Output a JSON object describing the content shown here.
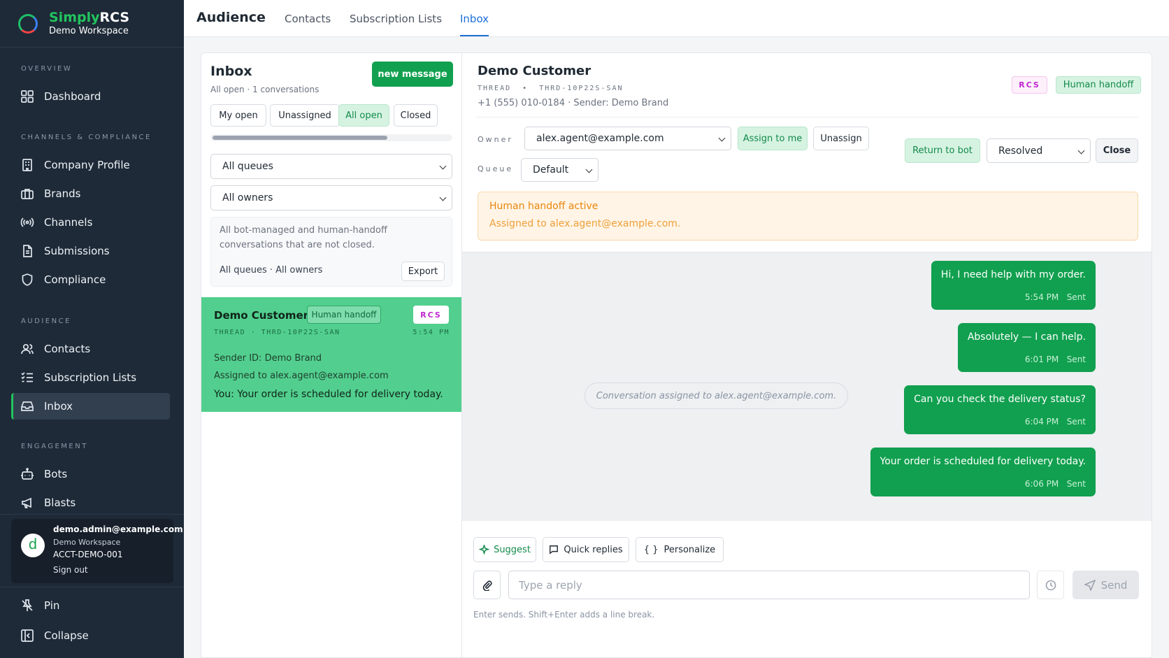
{
  "brand": {
    "simply": "Simply",
    "rcs": "RCS",
    "workspace": "Demo Workspace"
  },
  "nav": {
    "overview_label": "Overview",
    "dashboard": "Dashboard",
    "channels_label": "Channels & Compliance",
    "company_profile": "Company Profile",
    "brands": "Brands",
    "channels": "Channels",
    "submissions": "Submissions",
    "compliance": "Compliance",
    "audience_label": "Audience",
    "contacts": "Contacts",
    "subscription_lists": "Subscription Lists",
    "inbox": "Inbox",
    "engagement_label": "Engagement",
    "bots": "Bots",
    "blasts": "Blasts",
    "pin": "Pin",
    "collapse": "Collapse"
  },
  "user": {
    "initial": "d",
    "email": "demo.admin@example.com",
    "workspace": "Demo Workspace",
    "account": "ACCT-DEMO-001",
    "signout": "Sign out"
  },
  "header": {
    "title": "Audience",
    "tabs": [
      "Contacts",
      "Subscription Lists",
      "Inbox"
    ],
    "active_tab": "Inbox"
  },
  "inbox": {
    "title": "Inbox",
    "subtitle": "All open · 1 conversations",
    "new_message": "new message",
    "filters": [
      "My open",
      "Unassigned",
      "All open",
      "Closed"
    ],
    "queue_select": "All queues",
    "owner_select": "All owners",
    "description": "All bot-managed and human-handoff conversations that are not closed.",
    "summary": "All queues · All owners",
    "export": "Export",
    "conversation": {
      "name": "Demo Customer",
      "handoff_badge": "Human handoff",
      "channel": "RCS",
      "thread": "THREAD · THRD-10P22S-SAN",
      "time": "5:54 PM",
      "sender": "Sender ID: Demo Brand",
      "assigned": "Assigned to alex.agent@example.com",
      "preview": "You: Your order is scheduled for delivery today."
    }
  },
  "thread": {
    "name": "Demo Customer",
    "thread_id": "THREAD  •  THRD-10P22S-SAN",
    "contact": "+1 (555) 010-0184 · Sender: Demo Brand",
    "channel_badge": "RCS",
    "handoff_badge": "Human handoff",
    "owner_label": "Owner",
    "owner_value": "alex.agent@example.com",
    "assign_me": "Assign to me",
    "unassign": "Unassign",
    "queue_label": "Queue",
    "queue_value": "Default",
    "return_bot": "Return to bot",
    "status_value": "Resolved",
    "close": "Close",
    "alert_title": "Human handoff active",
    "alert_text": "Assigned to alex.agent@example.com."
  },
  "messages": [
    {
      "text": "Hi, I need help with my order.",
      "time": "5:54 PM",
      "status": "Sent"
    },
    {
      "text": "Absolutely — I can help.",
      "time": "6:01 PM",
      "status": "Sent"
    },
    {
      "text": "Can you check the delivery status?",
      "time": "6:04 PM",
      "status": "Sent"
    },
    {
      "text": "Your order is scheduled for delivery today.",
      "time": "6:06 PM",
      "status": "Sent"
    }
  ],
  "system_note": "Conversation assigned to alex.agent@example.com.",
  "composer": {
    "suggest": "Suggest",
    "quick_replies": "Quick replies",
    "personalize": "Personalize",
    "placeholder": "Type a reply",
    "send": "Send",
    "hint": "Enter sends. Shift+Enter adds a line break."
  },
  "colors": {
    "accent": "#11a04f",
    "sidebar": "#1e2a38",
    "link": "#1d6fd8",
    "warning": "#f59e0b"
  }
}
